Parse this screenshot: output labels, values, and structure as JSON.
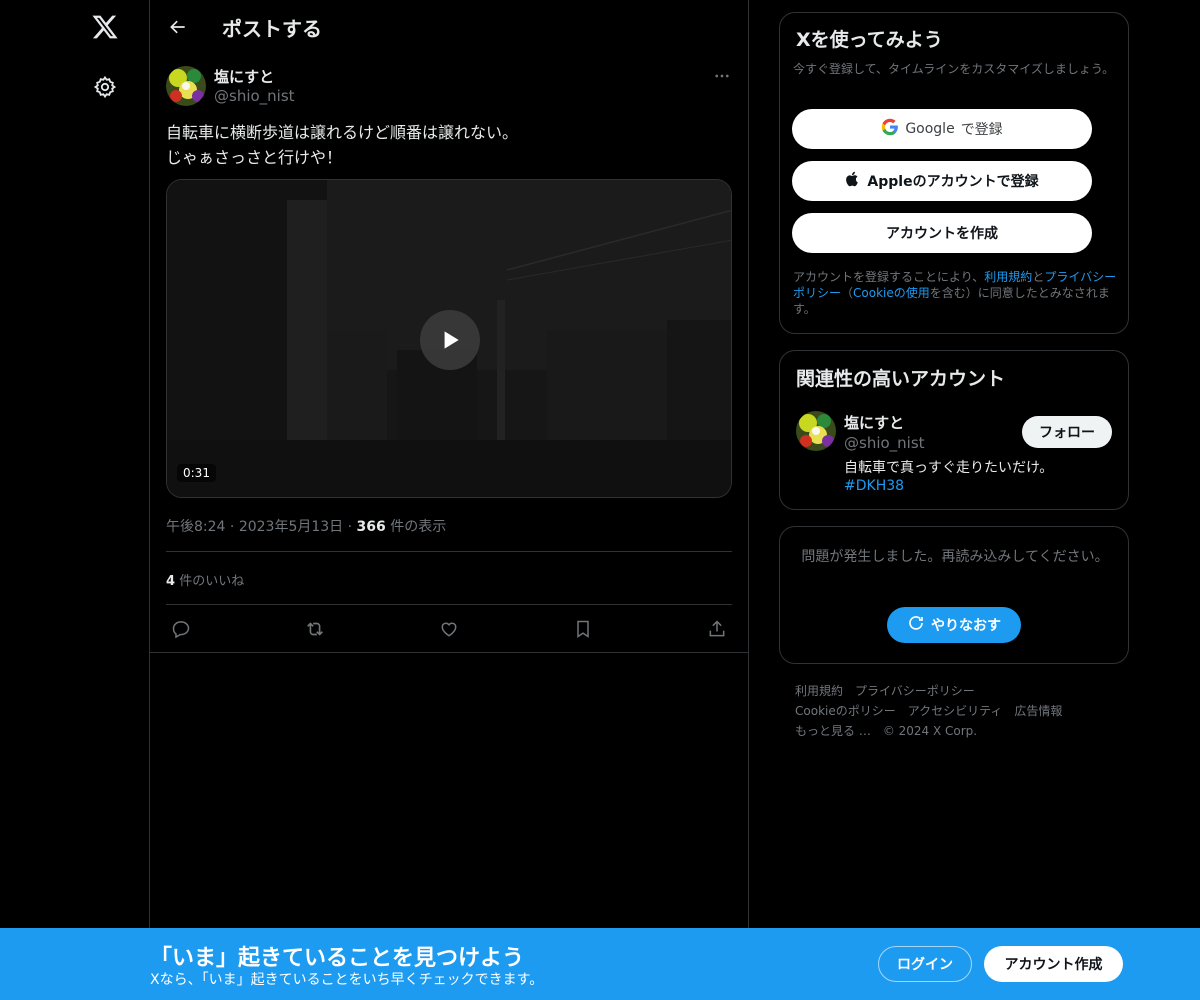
{
  "nav": {
    "logo_icon": "x-logo-icon",
    "settings_icon": "gear-icon"
  },
  "header": {
    "back_icon": "arrow-left-icon",
    "title": "ポストする"
  },
  "post": {
    "author_name": "塩にすと",
    "author_handle": "@shio_nist",
    "text_lines": [
      "自転車に横断歩道は譲れるけど順番は譲れない。",
      "じゃぁさっさと行けや！"
    ],
    "video": {
      "duration": "0:31",
      "play_icon": "play-icon"
    },
    "time": "午後8:24",
    "date": "2023年5月13日",
    "views_count": "366",
    "views_label": "件の表示",
    "likes_count": "4",
    "likes_label": "件のいいね",
    "actions": [
      "reply-icon",
      "repost-icon",
      "like-icon",
      "bookmark-icon",
      "share-icon"
    ]
  },
  "signup_card": {
    "title": "Xを使ってみよう",
    "subtitle": "今すぐ登録して、タイムラインをカスタマイズしましょう。",
    "google_brand": "Google",
    "google_suffix": "で登録",
    "apple_label": "Appleのアカウントで登録",
    "create_label": "アカウントを作成",
    "terms_1": "アカウントを登録することにより、",
    "terms_link_1": "利用規約",
    "terms_2": "と",
    "terms_link_2": "プライバシーポリシー",
    "terms_3": "（",
    "terms_link_3": "Cookieの使用",
    "terms_4": "を含む）に同意したとみなされます。"
  },
  "related_card": {
    "title": "関連性の高いアカウント",
    "account_name": "塩にすと",
    "account_handle": "@shio_nist",
    "follow_label": "フォロー",
    "bio": "自転車で真っすぐ走りたいだけ。",
    "hashtag": "#DKH38"
  },
  "error_card": {
    "message": "問題が発生しました。再読み込みしてください。",
    "retry_label": "やりなおす"
  },
  "footer": {
    "links": [
      "利用規約",
      "プライバシーポリシー",
      "Cookieのポリシー",
      "アクセシビリティ",
      "広告情報",
      "もっと見る …"
    ],
    "copyright": "© 2024 X Corp."
  },
  "banner": {
    "title": "「いま」起きていることを見つけよう",
    "subtitle": "Xなら、「いま」起きていることをいち早くチェックできます。",
    "login_label": "ログイン",
    "signup_label": "アカウント作成"
  },
  "colors": {
    "accent": "#1d9bf0",
    "background": "#000000",
    "border": "#2f3336",
    "muted": "#71767b"
  }
}
